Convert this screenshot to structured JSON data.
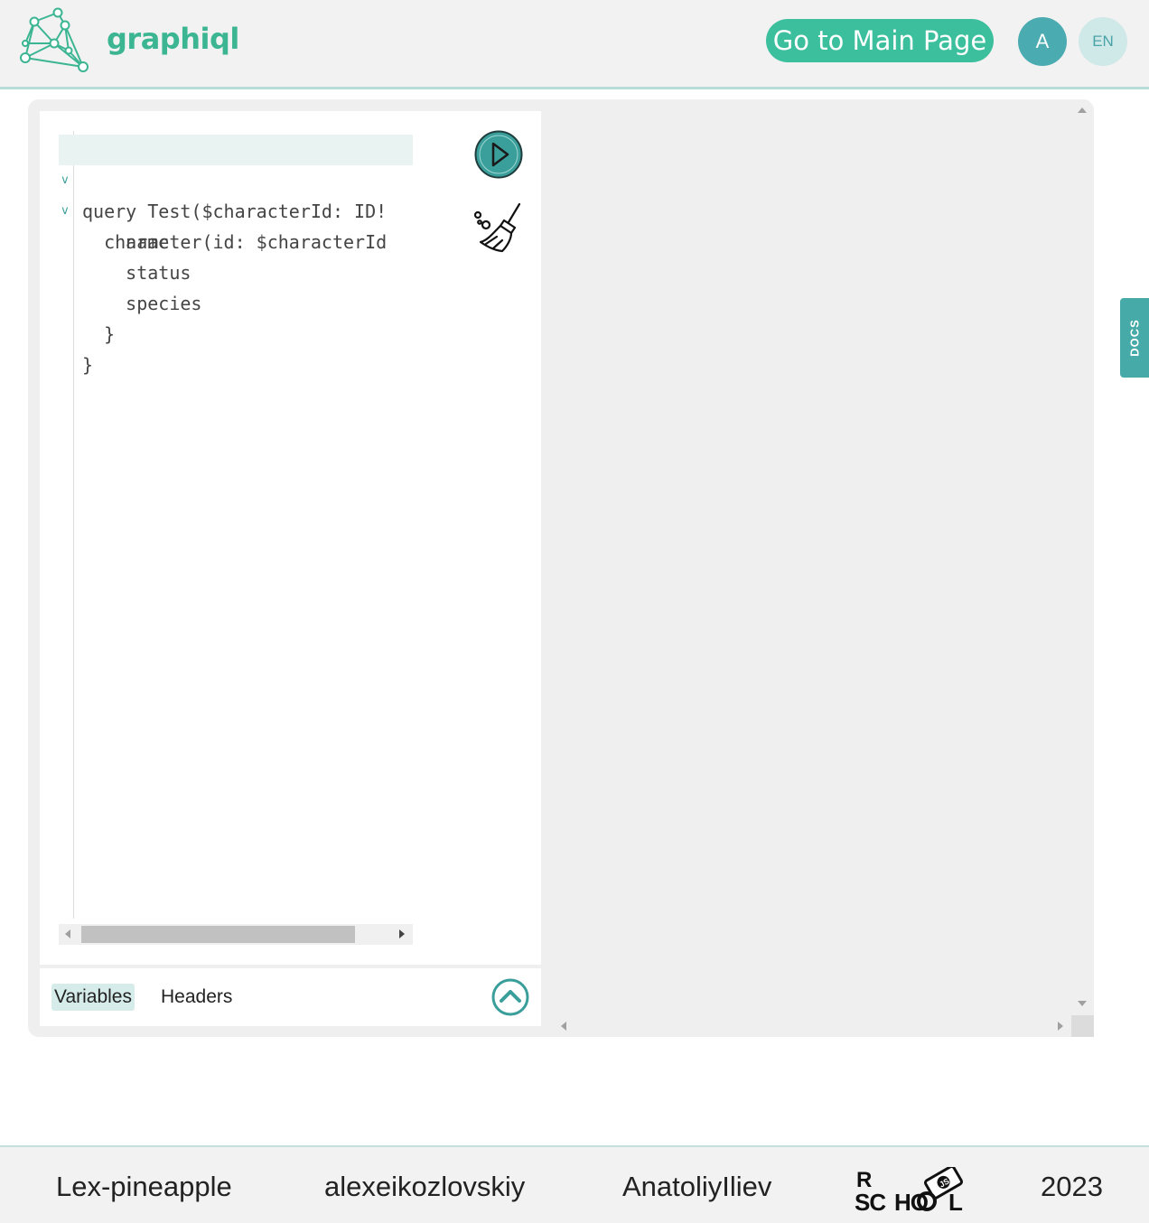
{
  "header": {
    "brand": "graphiql",
    "main_page_button": "Go to Main Page",
    "avatar_letter": "A",
    "language": "EN"
  },
  "editor": {
    "lines": [
      "query Test($characterId: ID!",
      "  character(id: $characterId",
      "    name",
      "    status",
      "    species",
      "  }",
      "}"
    ]
  },
  "tools": {
    "tabs": [
      "Variables",
      "Headers"
    ],
    "active_tab": "Variables"
  },
  "docs_tab": "DOCS",
  "footer": {
    "authors": [
      "Lex-pineapple",
      "alexeikozlovskiy",
      "AnatoliyIliev"
    ],
    "school_logo_text": "RS SCHOOL JS",
    "year": "2023"
  },
  "colors": {
    "brand_green": "#3bb592",
    "button_green": "#3cbf9d",
    "teal": "#45aaa8"
  }
}
